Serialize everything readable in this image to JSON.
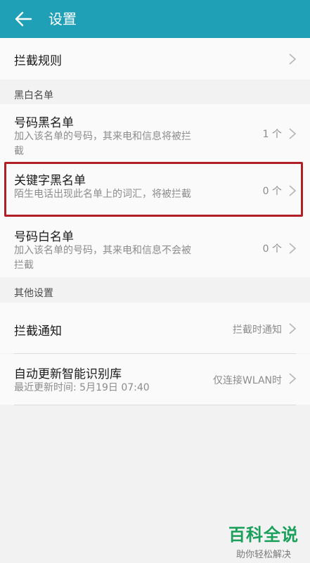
{
  "header": {
    "title": "设置",
    "back_icon": "arrow-left-icon"
  },
  "rules": {
    "title": "拦截规则"
  },
  "section_blackwhite": {
    "header": "黑白名单"
  },
  "number_blacklist": {
    "title": "号码黑名单",
    "subtitle": "加入该名单的号码，其来电和信息将被拦截",
    "value": "1 个"
  },
  "keyword_blacklist": {
    "title": "关键字黑名单",
    "subtitle": "陌生电话出现此名单上的词汇，将被拦截",
    "value": "0 个"
  },
  "number_whitelist": {
    "title": "号码白名单",
    "subtitle": "加入该名单的号码，其来电和信息不会被拦截",
    "value": "0 个"
  },
  "section_other": {
    "header": "其他设置"
  },
  "notification": {
    "title": "拦截通知",
    "value": "拦截时通知"
  },
  "auto_update": {
    "title": "自动更新智能识别库",
    "subtitle": "最近更新时间: 5月19日 07:40",
    "value": "仅连接WLAN时"
  },
  "watermark": {
    "main": "百科全说",
    "sub": "助你轻松解决"
  },
  "colors": {
    "appbar": "#1fa0b7",
    "highlight": "#b01e26",
    "watermark": "#1aa05a"
  }
}
